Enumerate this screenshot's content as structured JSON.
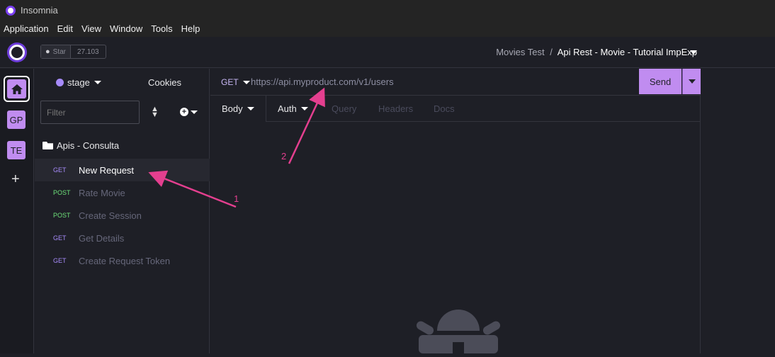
{
  "window": {
    "title": "Insomnia"
  },
  "menubar": [
    "Application",
    "Edit",
    "View",
    "Window",
    "Tools",
    "Help"
  ],
  "toolbar": {
    "github_star_label": "Star",
    "github_star_count": "27.103",
    "breadcrumb_parent": "Movies Test",
    "breadcrumb_separator": "/",
    "breadcrumb_current": "Api Rest - Movie - Tutorial ImpExp"
  },
  "rail": {
    "items": [
      "GP",
      "TE"
    ],
    "add_label": "+"
  },
  "sidebar": {
    "environment": "stage",
    "cookies_label": "Cookies",
    "filter_placeholder": "Filter",
    "folder": "Apis - Consulta",
    "requests": [
      {
        "method": "GET",
        "name": "New Request"
      },
      {
        "method": "POST",
        "name": "Rate Movie"
      },
      {
        "method": "POST",
        "name": "Create Session"
      },
      {
        "method": "GET",
        "name": "Get Details"
      },
      {
        "method": "GET",
        "name": "Create Request Token"
      }
    ]
  },
  "request": {
    "method": "GET",
    "url": "https://api.myproduct.com/v1/users",
    "send_label": "Send",
    "tabs": [
      "Body",
      "Auth",
      "Query",
      "Headers",
      "Docs"
    ]
  },
  "annotations": {
    "one": "1",
    "two": "2"
  },
  "colors": {
    "accent": "#c08cf0",
    "annotation": "#e43f8f",
    "get": "#a78bfa",
    "post": "#6ee27a"
  }
}
